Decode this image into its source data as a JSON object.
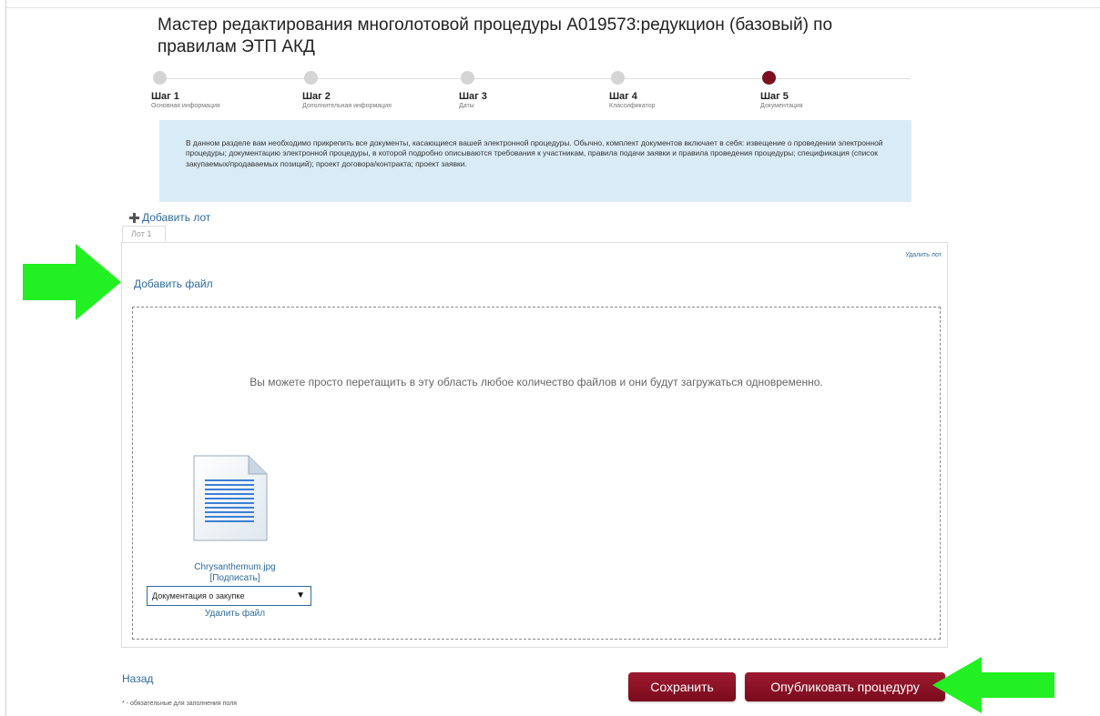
{
  "title": "Мастер редактирования многолотовой процедуры А019573:редукцион (базовый) по правилам ЭТП АКД",
  "steps": [
    {
      "num": "Шаг 1",
      "sub": "Основная информация",
      "active": false
    },
    {
      "num": "Шаг 2",
      "sub": "Дополнительная информация",
      "active": false
    },
    {
      "num": "Шаг 3",
      "sub": "Даты",
      "active": false
    },
    {
      "num": "Шаг 4",
      "sub": "Классификатор",
      "active": false
    },
    {
      "num": "Шаг 5",
      "sub": "Документация",
      "active": true
    }
  ],
  "info_text": "В данном разделе вам необходимо прикрепить все документы, касающиеся вашей электронной процедуры. Обычно, комплект документов включает в себя: извещение о проведении электронной процедуры; документацию электронной процедуры, в которой подробно описываются требования к участникам, правила подачи заявки и правила проведения процедуры; спецификация (список закупаемых/продаваемых позиций); проект договора/контракта; проект заявки.",
  "add_lot_label": "Добавить лот",
  "lot_tab_label": "Лот 1",
  "delete_lot_label": "Удалить лот",
  "add_file_label": "Добавить файл",
  "dropzone_text": "Вы можете просто перетащить в эту область любое количество файлов и они будут загружаться одновременно.",
  "file": {
    "name": "Chrysanthemum.jpg",
    "sign_label": "[Подписать]",
    "doc_type": "Документация о закупке",
    "delete_label": "Удалить файл"
  },
  "back_label": "Назад",
  "required_note": "* - обязательные для заполнения поля",
  "save_label": "Сохранить",
  "publish_label": "Опубликовать процедуру",
  "colors": {
    "accent": "#7b0d1e",
    "link": "#2e6b9e",
    "info_bg": "#d9ebf7",
    "annotation_arrow": "#22f022"
  }
}
